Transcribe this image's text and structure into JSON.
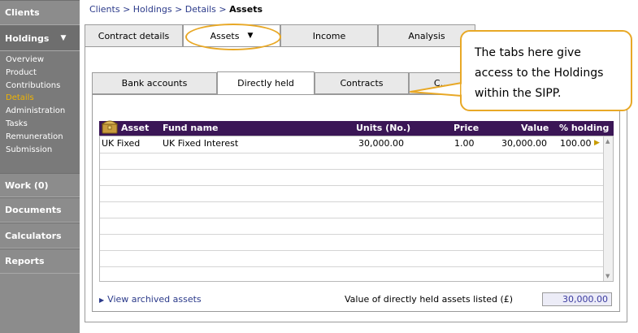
{
  "sidebar": {
    "sections": [
      {
        "label": "Clients"
      },
      {
        "label": "Holdings"
      },
      {
        "label": "Work (0)"
      },
      {
        "label": "Documents"
      },
      {
        "label": "Calculators"
      },
      {
        "label": "Reports"
      }
    ],
    "sub_items": [
      {
        "label": "Overview"
      },
      {
        "label": "Product"
      },
      {
        "label": "Contributions"
      },
      {
        "label": "Details"
      },
      {
        "label": "Administration"
      },
      {
        "label": "Tasks"
      },
      {
        "label": "Remuneration"
      },
      {
        "label": "Submission"
      }
    ],
    "selected_color": "#f0b400"
  },
  "breadcrumb": {
    "path": "Clients > Holdings > Details > ",
    "current": "Assets"
  },
  "top_tabs": [
    {
      "label": "Contract details"
    },
    {
      "label": "Assets"
    },
    {
      "label": "Income"
    },
    {
      "label": "Analysis"
    }
  ],
  "sub_tabs": [
    {
      "label": "Bank accounts"
    },
    {
      "label": "Directly held"
    },
    {
      "label": "Contracts"
    },
    {
      "label": "C..."
    }
  ],
  "table": {
    "headers": [
      "Asset",
      "Fund name",
      "Units (No.)",
      "Price",
      "Value",
      "% holding"
    ],
    "rows": [
      {
        "asset": "UK Fixed",
        "fund": "UK Fixed Interest",
        "units": "30,000.00",
        "price": "1.00",
        "value": "30,000.00",
        "holding": "100.00"
      }
    ],
    "header_color": "#3b1656"
  },
  "footer": {
    "archived_link": "View archived assets",
    "total_label": "Value of directly held assets listed (£)",
    "total_value": "30,000.00"
  },
  "callout": {
    "text": "The tabs here give access to the Holdings within the SIPP.",
    "color": "#e8a826"
  }
}
